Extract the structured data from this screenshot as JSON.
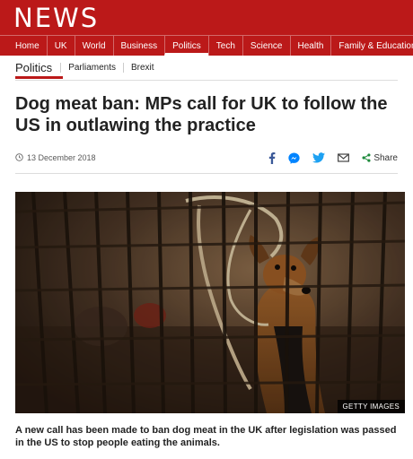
{
  "brand": {
    "logo_text": "NEWS",
    "accent": "#bb1919"
  },
  "topnav": {
    "items": [
      {
        "label": "Home"
      },
      {
        "label": "UK"
      },
      {
        "label": "World"
      },
      {
        "label": "Business"
      },
      {
        "label": "Politics",
        "active": true
      },
      {
        "label": "Tech"
      },
      {
        "label": "Science"
      },
      {
        "label": "Health"
      },
      {
        "label": "Family & Education"
      }
    ]
  },
  "subnav": {
    "section": "Politics",
    "items": [
      "Parliaments",
      "Brexit"
    ]
  },
  "article": {
    "headline": "Dog meat ban: MPs call for UK to follow the US in outlawing the practice",
    "date": "13 December 2018",
    "share_label": "Share",
    "share_icons": [
      "facebook-icon",
      "messenger-icon",
      "twitter-icon",
      "email-icon",
      "share-icon"
    ],
    "image_credit": "GETTY IMAGES",
    "lead": "A new call has been made to ban dog meat in the UK after legislation was passed in the US to stop people eating the animals."
  }
}
